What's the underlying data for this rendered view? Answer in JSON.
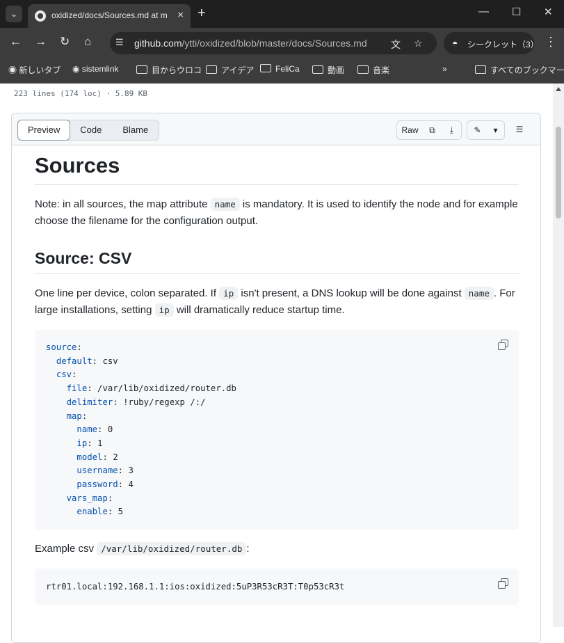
{
  "browser": {
    "tab_title": "oxidized/docs/Sources.md at m",
    "url_host": "github.com",
    "url_path": "/ytti/oxidized/blob/master/docs/Sources.md",
    "incognito_label": "シークレット（3）",
    "bookmarks": [
      "新しいタブ",
      "sistemlink",
      "目からウロコ",
      "アイデア",
      "FeliCa",
      "動画",
      "音楽"
    ],
    "all_bookmarks": "すべてのブックマーク"
  },
  "file": {
    "meta": "223 lines (174 loc) · 5.89 KB",
    "views": [
      "Preview",
      "Code",
      "Blame"
    ],
    "raw_label": "Raw"
  },
  "doc": {
    "title": "Sources",
    "note_prefix": "Note: in all sources, the map attribute ",
    "note_code": "name",
    "note_suffix": " is mandatory. It is used to identify the node and for example choose the filename for the configuration output.",
    "csv_heading": "Source: CSV",
    "csv_p1": "One line per device, colon separated. If ",
    "csv_code_ip": "ip",
    "csv_p2": " isn't present, a DNS lookup will be done against ",
    "csv_code_name": "name",
    "csv_p3": ". For large installations, setting ",
    "csv_code_ip2": "ip",
    "csv_p4": " will dramatically reduce startup time.",
    "yaml_lines": [
      "source:",
      "  default: csv",
      "  csv:",
      "    file: /var/lib/oxidized/router.db",
      "    delimiter: !ruby/regexp /:/",
      "    map:",
      "      name: 0",
      "      ip: 1",
      "      model: 2",
      "      username: 3",
      "      password: 4",
      "    vars_map:",
      "      enable: 5"
    ],
    "example_prefix": "Example csv ",
    "example_code": "/var/lib/oxidized/router.db",
    "example_suffix": ":",
    "example_line": "rtr01.local:192.168.1.1:ios:oxidized:5uP3R53cR3T:T0p53cR3t"
  }
}
